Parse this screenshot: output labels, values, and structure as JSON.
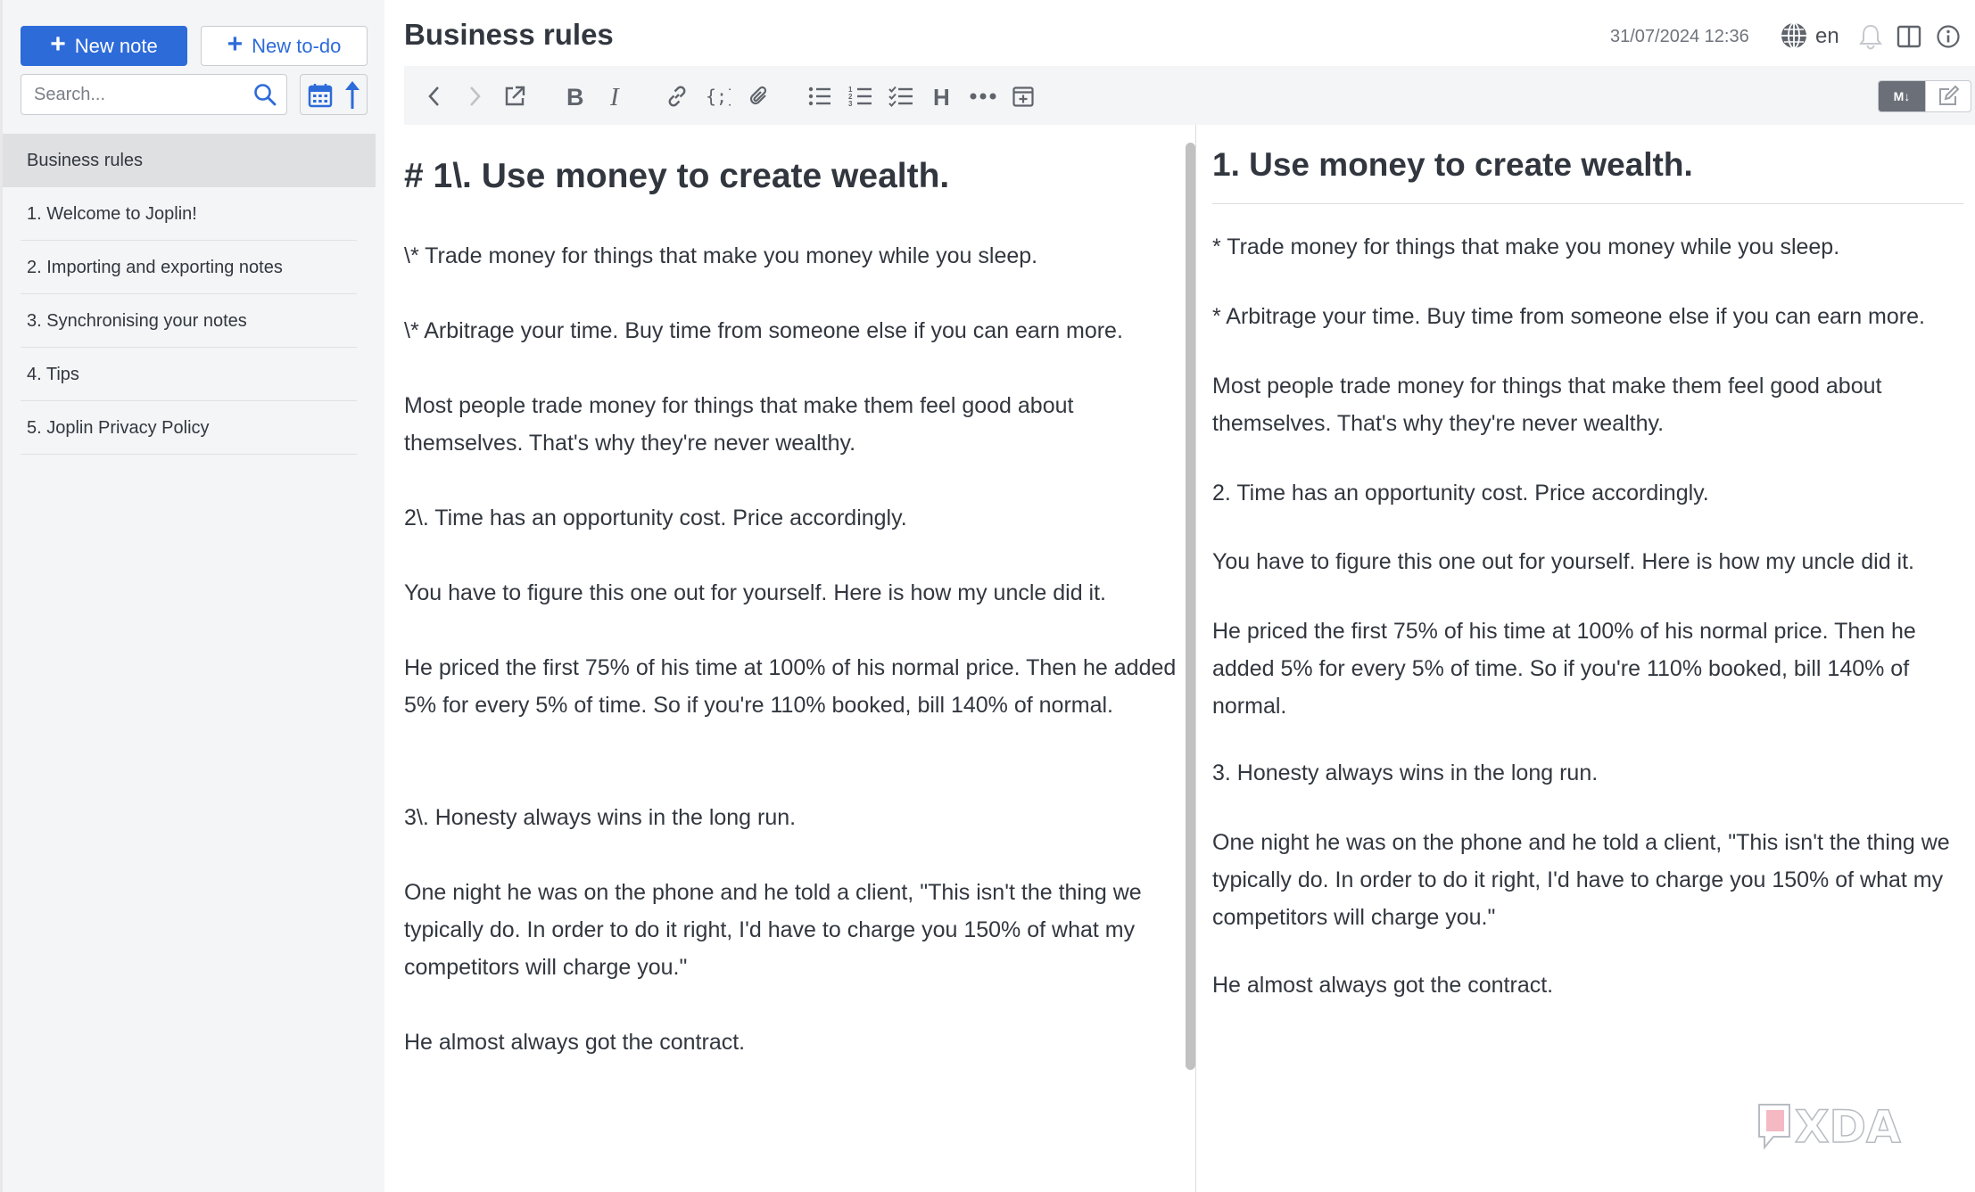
{
  "sidebar": {
    "new_note_label": "New note",
    "new_todo_label": "New to-do",
    "search_placeholder": "Search...",
    "notes": [
      {
        "title": "Business rules"
      },
      {
        "title": "1. Welcome to Joplin!"
      },
      {
        "title": "2. Importing and exporting notes"
      },
      {
        "title": "3. Synchronising your notes"
      },
      {
        "title": "4. Tips"
      },
      {
        "title": "5. Joplin Privacy Policy"
      }
    ]
  },
  "header": {
    "title": "Business rules",
    "date": "31/07/2024 12:36",
    "language": "en"
  },
  "toolbar": {
    "icons": [
      "back-icon",
      "forward-icon",
      "external-edit-icon",
      "bold-icon",
      "italic-icon",
      "link-icon",
      "code-icon",
      "attach-icon",
      "bullet-list-icon",
      "numbered-list-icon",
      "checklist-icon",
      "heading-icon",
      "more-icon",
      "insert-time-icon"
    ],
    "markdown_toggle_label": "M↓"
  },
  "editor": {
    "heading": "# 1\\. Use money to create wealth.",
    "paragraphs": [
      "\\* Trade money for things that make you money while you sleep.",
      "\\* Arbitrage your time. Buy time from someone else if you can earn more.",
      "Most people trade money for things that make them feel good about themselves. That's why they're never wealthy.",
      "2\\. Time has an opportunity cost. Price accordingly.",
      "You have to figure this one out for yourself. Here is how my uncle did it.",
      "He priced the first 75% of his time at 100% of his normal price. Then he added 5% for every 5% of time. So if you're 110% booked, bill 140% of normal.",
      "3\\. Honesty always wins in the long run.",
      "One night he was on the phone and he told a client, \"This isn't the thing we typically do. In order to do it right, I'd have to charge you 150% of what my competitors will charge you.\"",
      "He almost always got the contract."
    ]
  },
  "preview": {
    "heading": "1. Use money to create wealth.",
    "paragraphs": [
      "* Trade money for things that make you money while you sleep.",
      "* Arbitrage your time. Buy time from someone else if you can earn more.",
      "Most people trade money for things that make them feel good about themselves. That's why they're never wealthy.",
      "2. Time has an opportunity cost. Price accordingly.",
      "You have to figure this one out for yourself. Here is how my uncle did it.",
      "He priced the first 75% of his time at 100% of his normal price. Then he added 5% for every 5% of time. So if you're 110% booked, bill 140% of normal.",
      "3. Honesty always wins in the long run.",
      "One night he was on the phone and he told a client, \"This isn't the thing we typically do. In order to do it right, I'd have to charge you 150% of what my competitors will charge you.\"",
      "He almost always got the contract."
    ]
  },
  "colors": {
    "accent": "#2d6bd9",
    "text": "#32373f",
    "sidebar_bg": "#f4f5f6",
    "selected_bg": "#dfe0e2"
  },
  "watermark": {
    "brand": "XDA"
  }
}
